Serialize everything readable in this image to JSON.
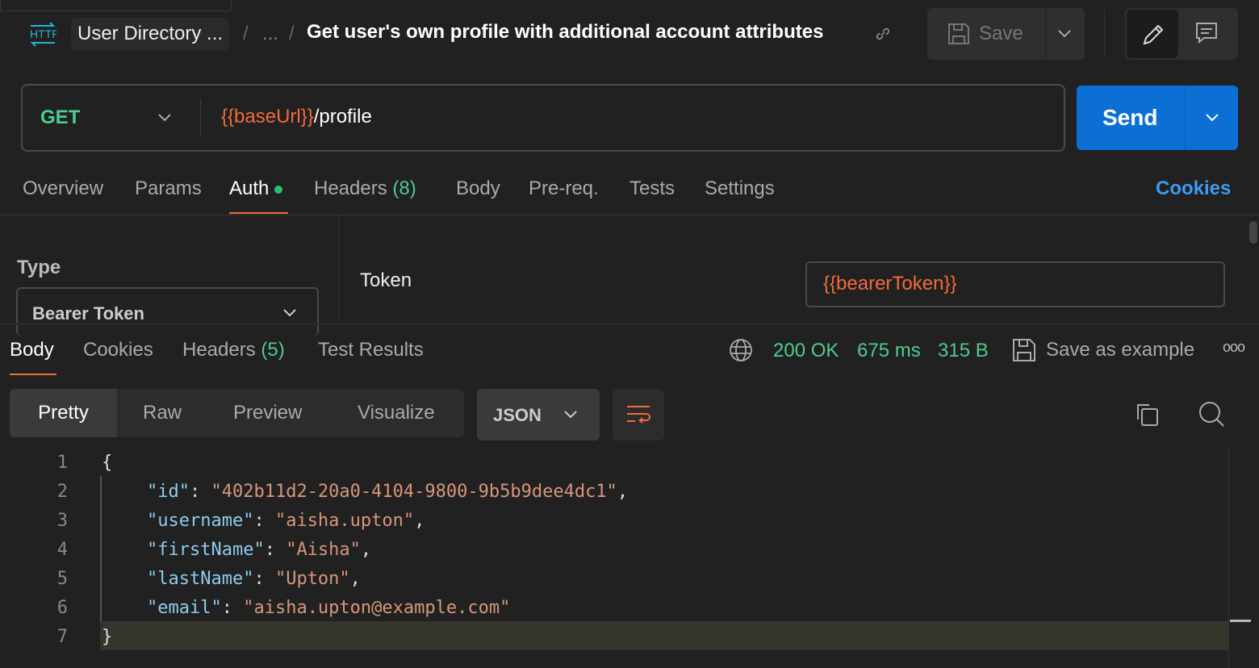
{
  "header": {
    "icon": "http-icon",
    "collection": "User Directory ...",
    "ellipsis": "...",
    "title": "Get user's own profile with additional account attributes",
    "save_label": "Save"
  },
  "request": {
    "method": "GET",
    "url_var": "{{baseUrl}}",
    "url_path": "/profile",
    "send_label": "Send"
  },
  "request_tabs": [
    {
      "label": "Overview"
    },
    {
      "label": "Params"
    },
    {
      "label": "Auth",
      "active": true
    },
    {
      "label": "Headers",
      "count": "(8)"
    },
    {
      "label": "Body"
    },
    {
      "label": "Pre-req."
    },
    {
      "label": "Tests"
    },
    {
      "label": "Settings"
    }
  ],
  "cookies_label": "Cookies",
  "auth": {
    "type_label": "Type",
    "type_value": "Bearer Token",
    "token_label": "Token",
    "token_value": "{{bearerToken}}"
  },
  "response_tabs": [
    {
      "label": "Body",
      "active": true
    },
    {
      "label": "Cookies"
    },
    {
      "label": "Headers",
      "count": "(5)"
    },
    {
      "label": "Test Results"
    }
  ],
  "status": {
    "code": "200 OK",
    "time": "675 ms",
    "size": "315 B",
    "save_example": "Save as example"
  },
  "view_modes": [
    "Pretty",
    "Raw",
    "Preview",
    "Visualize"
  ],
  "format": "JSON",
  "code_lines": [
    {
      "n": "1",
      "t": "{"
    },
    {
      "n": "2",
      "k": "\"id\"",
      "v": "\"402b11d2-20a0-4104-9800-9b5b9dee4dc1\"",
      "e": ","
    },
    {
      "n": "3",
      "k": "\"username\"",
      "v": "\"aisha.upton\"",
      "e": ","
    },
    {
      "n": "4",
      "k": "\"firstName\"",
      "v": "\"Aisha\"",
      "e": ","
    },
    {
      "n": "5",
      "k": "\"lastName\"",
      "v": "\"Upton\"",
      "e": ","
    },
    {
      "n": "6",
      "k": "\"email\"",
      "v": "\"aisha.upton@example.com\"",
      "e": ""
    },
    {
      "n": "7",
      "t": "}"
    }
  ],
  "colors": {
    "accent": "#0b6fd4",
    "green": "#4ecb8d",
    "variable": "#f26b3a"
  }
}
